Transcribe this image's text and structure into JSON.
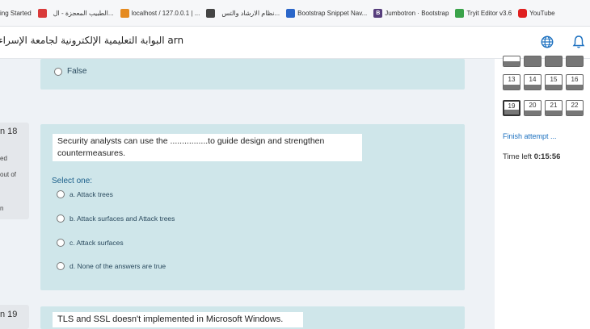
{
  "bookmarks": [
    {
      "label": "ing Started",
      "icon": "gray"
    },
    {
      "label": "",
      "icon": "red"
    },
    {
      "label": "الطبيب المعجزة - ال...",
      "icon": "gray"
    },
    {
      "label": "localhost / 127.0.0.1 | ...",
      "icon": "orange"
    },
    {
      "label": "",
      "icon": "dark"
    },
    {
      "label": "نظام الارشاد والتس...",
      "icon": "gray"
    },
    {
      "label": "Bootstrap Snippet Nav...",
      "icon": "blue"
    },
    {
      "label": "Jumbotron · Bootstrap",
      "icon": "purple"
    },
    {
      "label": "Tryit Editor v3.6",
      "icon": "green"
    },
    {
      "label": "YouTube",
      "icon": "yt"
    }
  ],
  "header": {
    "site_title": "البوابة التعليمية الإلكترونية لجامعة الإسراء  arn"
  },
  "question17": {
    "last_option": "False"
  },
  "question18": {
    "number_label": "n 18",
    "status_label": "ed",
    "mark_label": "out of",
    "flag_label": "n",
    "text_line1": "Security analysts can use the ................to guide design and strengthen",
    "text_line2": "countermeasures.",
    "select_one": "Select one:",
    "options": [
      "a. Attack trees",
      "b. Attack surfaces and Attack trees",
      "c. Attack surfaces",
      "d. None of the answers are true"
    ]
  },
  "question19": {
    "number_label": "n 19",
    "text": "TLS and SSL doesn't implemented in Microsoft Windows."
  },
  "quiz_nav": {
    "row2": [
      "13",
      "14",
      "15",
      "16"
    ],
    "row3": [
      "19",
      "20",
      "21",
      "22"
    ],
    "finish_attempt": "Finish attempt ...",
    "time_left_label": "Time left",
    "time_left_value": "0:15:56"
  },
  "colors": {
    "panel": "#cfe6ea",
    "link": "#1a6fbf",
    "page_bg": "#eef2f6"
  }
}
